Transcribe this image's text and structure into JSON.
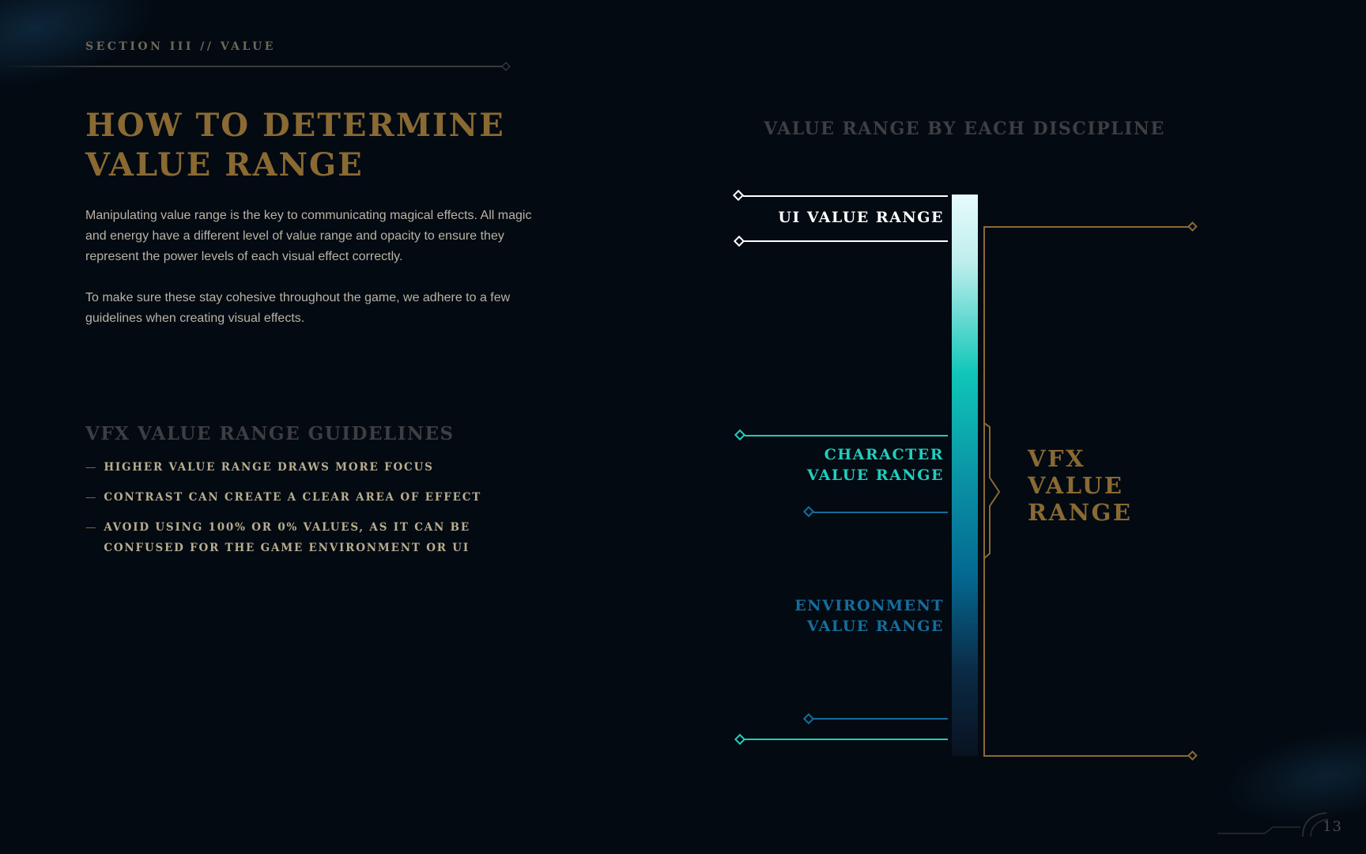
{
  "header": {
    "section_label": "SECTION III // VALUE"
  },
  "intro": {
    "title_line1": "HOW TO DETERMINE",
    "title_line2": "VALUE RANGE",
    "paragraph1": "Manipulating value range is the key to communicating magical effects. All magic and energy have a different level of value range and opacity to ensure they represent the power levels of each visual effect correctly.",
    "paragraph2": "To make sure these stay cohesive throughout the game, we adhere to a few guidelines when creating visual effects."
  },
  "guidelines": {
    "title": "VFX VALUE RANGE GUIDELINES",
    "dash": "—",
    "items": [
      "HIGHER VALUE RANGE DRAWS MORE FOCUS",
      "CONTRAST CAN CREATE A CLEAR AREA OF EFFECT",
      "AVOID USING 100% OR 0% VALUES, AS IT CAN BE CONFUSED FOR THE GAME ENVIRONMENT OR UI"
    ]
  },
  "diagram": {
    "title": "VALUE RANGE BY EACH DISCIPLINE",
    "ui_label": "UI VALUE RANGE",
    "character_label_line1": "CHARACTER",
    "character_label_line2": "VALUE RANGE",
    "environment_label_line1": "ENVIRONMENT",
    "environment_label_line2": "VALUE RANGE",
    "vfx_label_line1": "VFX",
    "vfx_label_line2": "VALUE",
    "vfx_label_line3": "RANGE",
    "colors": {
      "ui": "#ffffff",
      "character": "#21cdbd",
      "environment": "#166d9c",
      "vfx": "#8a6a32",
      "gradient_top": "#e6fbfb",
      "gradient_mid": "#0fc6b8",
      "gradient_low": "#046891",
      "gradient_bottom": "#091220"
    }
  },
  "footer": {
    "page_number": "13"
  }
}
